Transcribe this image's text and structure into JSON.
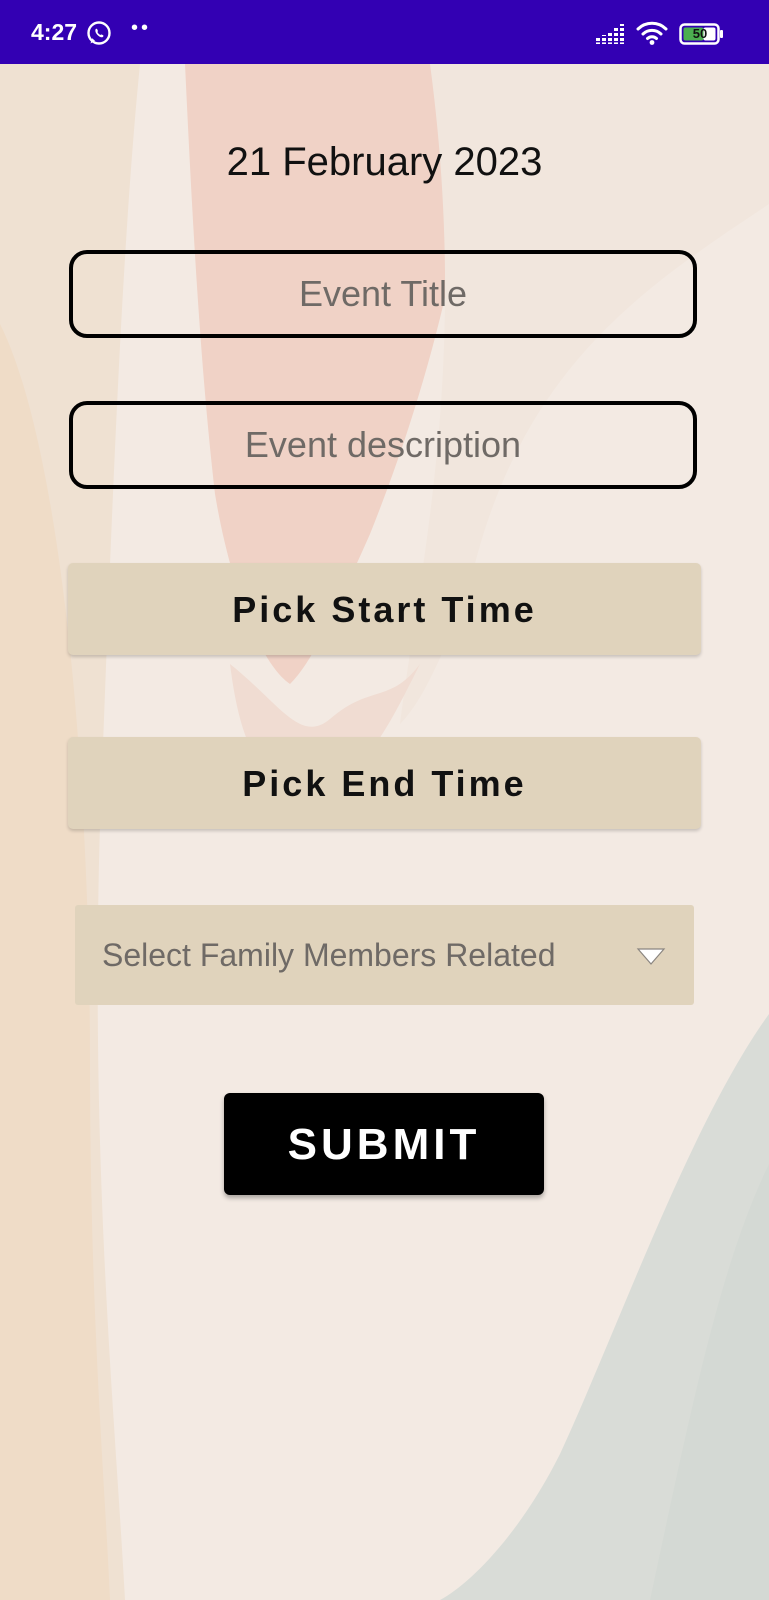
{
  "status_bar": {
    "time": "4:27",
    "notification_dots": "••",
    "battery_level": "50",
    "background_color": "#3300b3",
    "icons": [
      "whatsapp-icon",
      "signal-icon",
      "wifi-icon",
      "battery-icon"
    ]
  },
  "form": {
    "date": "21 February 2023",
    "event_title_placeholder": "Event Title",
    "event_description_placeholder": "Event description",
    "pick_start_label": "Pick Start Time",
    "pick_end_label": "Pick End Time",
    "family_members_label": "Select Family Members Related",
    "submit_label": "SUBMIT"
  },
  "colors": {
    "button_fill": "#e0d3bc",
    "submit_fill": "#000000",
    "background": "#f2e9e0"
  }
}
